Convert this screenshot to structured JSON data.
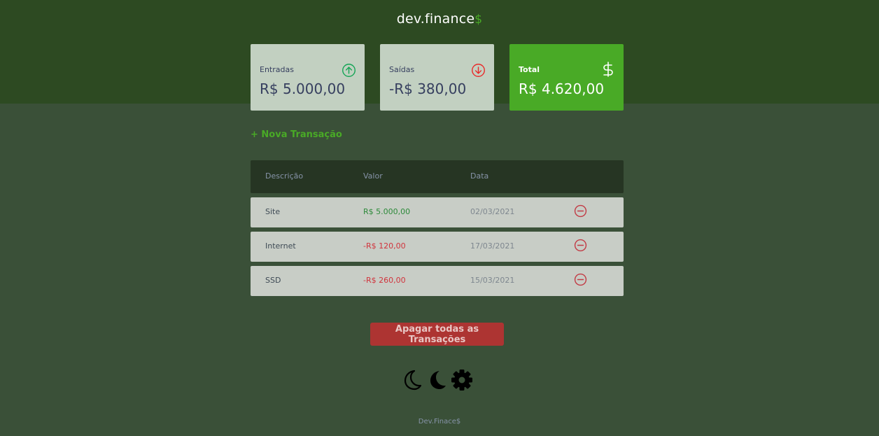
{
  "app": {
    "logo_text": "dev.finance",
    "logo_symbol": "$"
  },
  "summary": {
    "income": {
      "label": "Entradas",
      "amount": "R$ 5.000,00",
      "icon": "arrow-up-circle-icon"
    },
    "expense": {
      "label": "Saídas",
      "amount": "-R$ 380,00",
      "icon": "arrow-down-circle-icon"
    },
    "total": {
      "label": "Total",
      "amount": "R$ 4.620,00",
      "icon": "dollar-icon"
    }
  },
  "actions": {
    "new_transaction": "+ Nova Transação",
    "clear_all": "Apagar todas as Transações"
  },
  "table": {
    "headers": [
      "Descrição",
      "Valor",
      "Data"
    ],
    "rows": [
      {
        "description": "Site",
        "amount": "R$ 5.000,00",
        "date": "02/03/2021",
        "type": "income"
      },
      {
        "description": "Internet",
        "amount": "-R$ 120,00",
        "date": "17/03/2021",
        "type": "expense"
      },
      {
        "description": "SSD",
        "amount": "-R$ 260,00",
        "date": "15/03/2021",
        "type": "expense"
      }
    ]
  },
  "theme_controls": [
    "moon-outline-icon",
    "moon-filled-icon",
    "gear-icon"
  ],
  "footer": {
    "text": "Dev.Finace$"
  },
  "colors": {
    "header_bg": "#2d4a22",
    "page_bg": "#3a5038",
    "accent_green": "#49aa26",
    "income_green": "#2d8a3a",
    "expense_red": "#d1333c",
    "danger_button": "#ad3432",
    "card_bg": "#c2d0c1",
    "row_bg": "#c8cdc6",
    "table_header_bg": "#263523"
  }
}
